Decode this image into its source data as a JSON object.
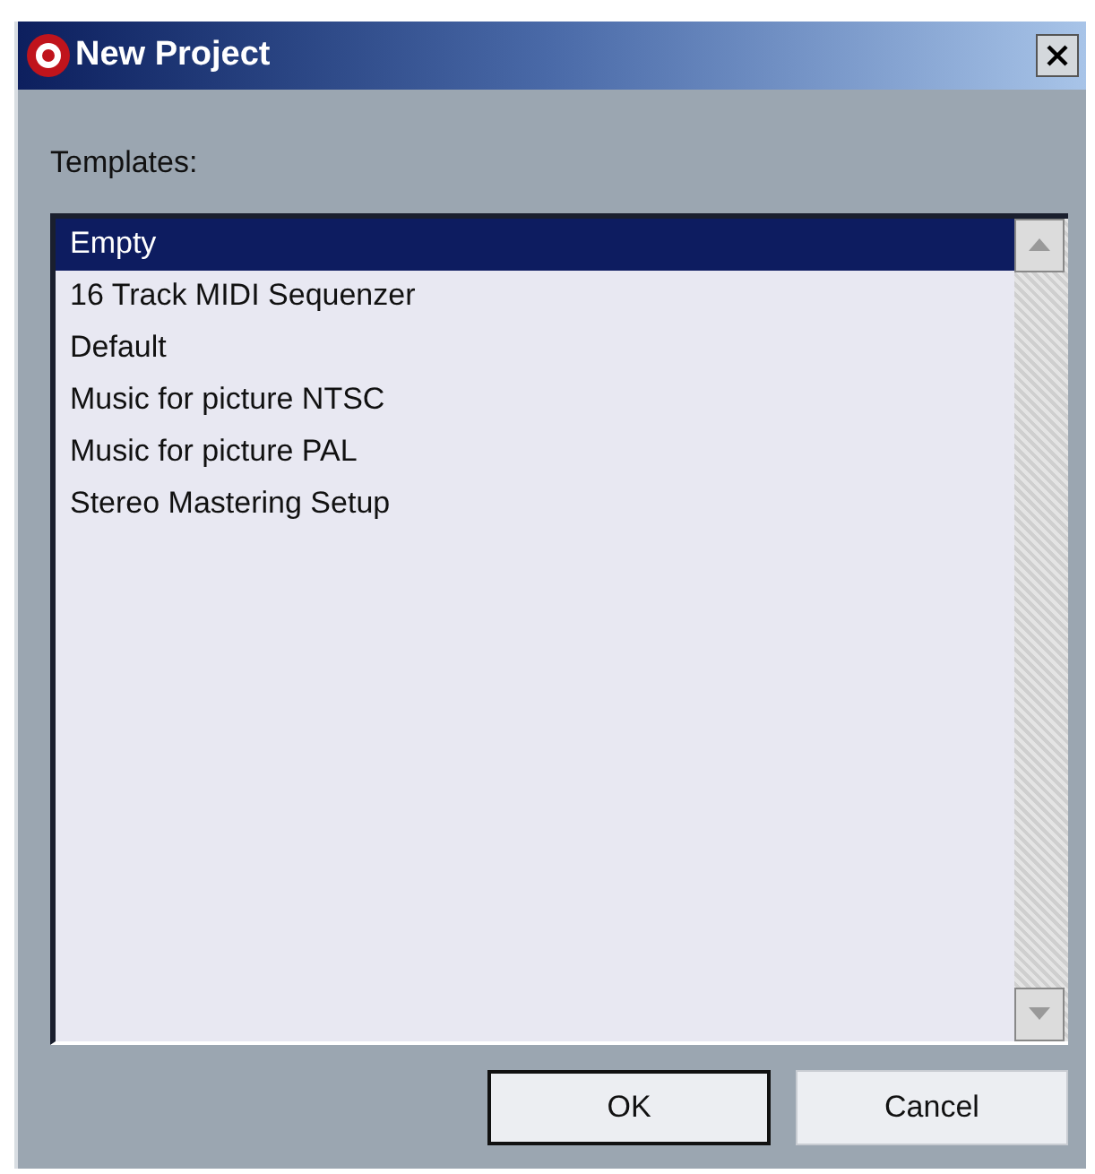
{
  "window": {
    "title": "New Project"
  },
  "templates_label": "Templates:",
  "templates": [
    {
      "label": "Empty",
      "selected": true
    },
    {
      "label": "16 Track MIDI Sequenzer",
      "selected": false
    },
    {
      "label": "Default",
      "selected": false
    },
    {
      "label": "Music for picture NTSC",
      "selected": false
    },
    {
      "label": "Music for picture PAL",
      "selected": false
    },
    {
      "label": "Stereo Mastering Setup",
      "selected": false
    }
  ],
  "buttons": [
    {
      "label": "OK",
      "default": true
    },
    {
      "label": "Cancel",
      "default": false
    }
  ]
}
